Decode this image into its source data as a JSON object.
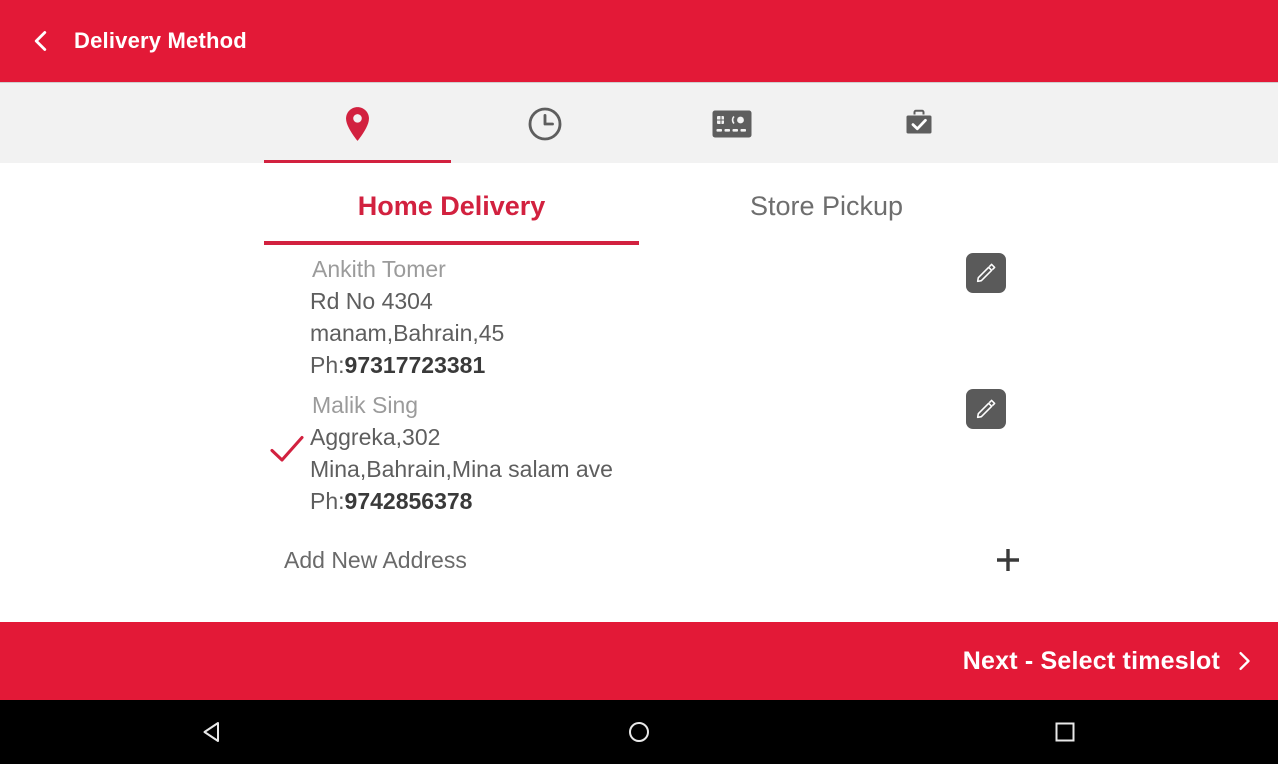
{
  "appbar": {
    "back_icon": "chevron-left-icon",
    "title": "Delivery Method"
  },
  "icon_tabs": [
    {
      "icon": "location-pin-icon",
      "active": true,
      "color": "#D2213F"
    },
    {
      "icon": "clock-icon",
      "active": false,
      "color": "#5E5E5E"
    },
    {
      "icon": "credit-card-icon",
      "active": false,
      "color": "#5E5E5E"
    },
    {
      "icon": "briefcase-check-icon",
      "active": false,
      "color": "#5E5E5E"
    }
  ],
  "mode_tabs": [
    {
      "label": "Home Delivery",
      "active": true
    },
    {
      "label": "Store Pickup",
      "active": false
    }
  ],
  "addresses": [
    {
      "name": "Ankith Tomer",
      "line1": "Rd No 4304",
      "line2": "manam,Bahrain,45",
      "phone_label": "Ph:",
      "phone": "97317723381",
      "selected": false,
      "edit_icon": "pencil-icon"
    },
    {
      "name": "Malik Sing",
      "line1": "Aggreka,302",
      "line2": "Mina,Bahrain,Mina salam ave",
      "phone_label": "Ph:",
      "phone": "9742856378",
      "selected": true,
      "edit_icon": "pencil-icon"
    }
  ],
  "add_new": {
    "label": "Add New Address",
    "icon": "plus-icon"
  },
  "next_bar": {
    "label": "Next - Select timeslot",
    "icon": "chevron-right-icon"
  },
  "navbar": [
    {
      "icon": "android-back-icon"
    },
    {
      "icon": "android-home-icon"
    },
    {
      "icon": "android-recents-icon"
    }
  ],
  "colors": {
    "brand_red": "#E31937",
    "accent_red": "#D2213F",
    "tab_bg": "#F2F2F2",
    "text_gray": "#5E5E5E",
    "muted_gray": "#9B9B9B",
    "edit_btn": "#5A5A5A"
  }
}
